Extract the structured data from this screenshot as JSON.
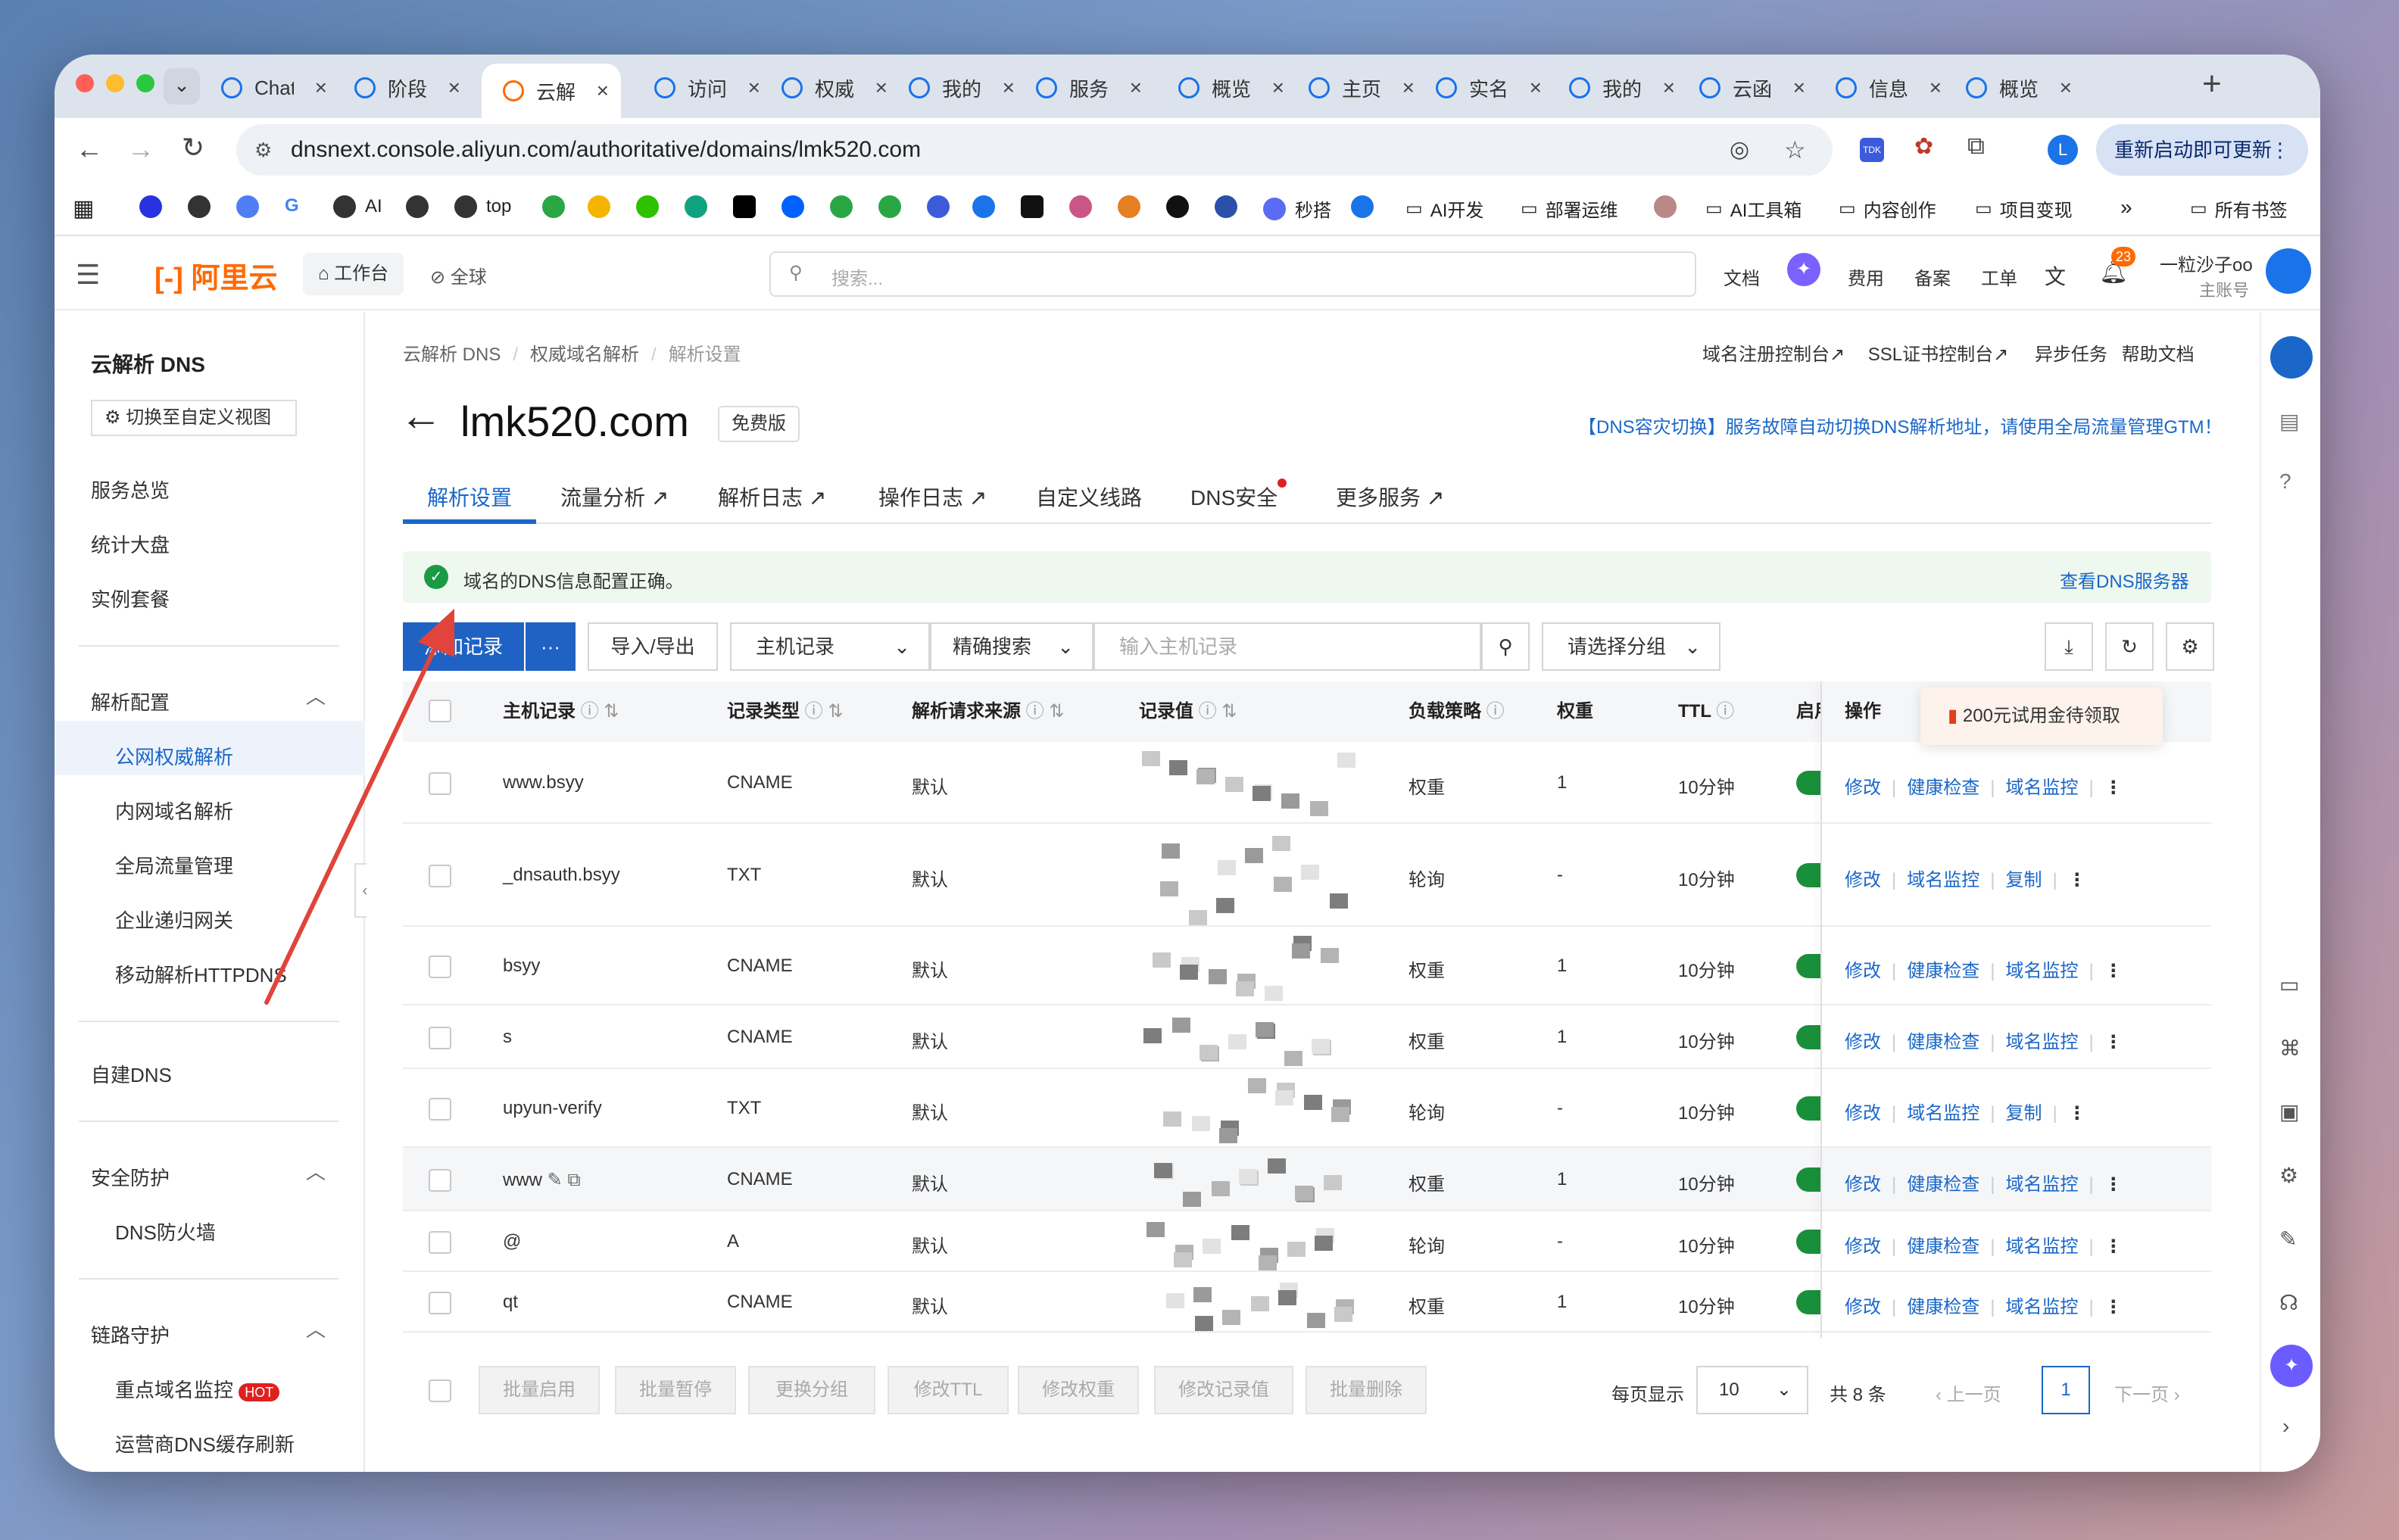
{
  "browser": {
    "tabs": [
      {
        "label": "ChatGPT",
        "active": false
      },
      {
        "label": "阶段",
        "active": false
      },
      {
        "label": "云解析",
        "active": true
      },
      {
        "label": "访问",
        "active": false
      },
      {
        "label": "权威",
        "active": false
      },
      {
        "label": "我的",
        "active": false
      },
      {
        "label": "服务",
        "active": false
      },
      {
        "label": "概览",
        "active": false
      },
      {
        "label": "主页",
        "active": false
      },
      {
        "label": "实名",
        "active": false
      },
      {
        "label": "我的",
        "active": false
      },
      {
        "label": "云函",
        "active": false
      },
      {
        "label": "信息",
        "active": false
      },
      {
        "label": "概览",
        "active": false
      }
    ],
    "url": "dnsnext.console.aliyun.com/authoritative/domains/lmk520.com",
    "update_label": "重新启动即可更新",
    "profile_initial": "L",
    "bookmarks": {
      "ai": "AI",
      "top": "top",
      "miaoda": "秒搭",
      "folder_ai_dev": "AI开发",
      "folder_deploy": "部署运维",
      "folder_ai_tools": "AI工具箱",
      "folder_content": "内容创作",
      "folder_project": "项目变现",
      "all": "所有书签"
    }
  },
  "header": {
    "logo": "阿里云",
    "workbench": "工作台",
    "region": "全球",
    "search_placeholder": "搜索...",
    "docs": "文档",
    "fees": "费用",
    "filing": "备案",
    "tickets": "工单",
    "notifications": "23",
    "user_name": "一粒沙子oo",
    "user_role": "主账号"
  },
  "sidebar": {
    "title": "云解析 DNS",
    "switch_view": "切换至自定义视图",
    "items": {
      "overview": "服务总览",
      "dashboard": "统计大盘",
      "instances": "实例套餐"
    },
    "group_config": "解析配置",
    "config_items": [
      "公网权威解析",
      "内网域名解析",
      "全局流量管理",
      "企业递归网关",
      "移动解析HTTPDNS"
    ],
    "self_dns": "自建DNS",
    "group_security": "安全防护",
    "security_items": [
      "DNS防火墙"
    ],
    "group_chain": "链路守护",
    "chain_items": [
      "重点域名监控",
      "运营商DNS缓存刷新"
    ],
    "hot_badge": "HOT"
  },
  "breadcrumb": [
    "云解析 DNS",
    "权威域名解析",
    "解析设置"
  ],
  "top_links": [
    "域名注册控制台",
    "SSL证书控制台",
    "异步任务",
    "帮助文档"
  ],
  "domain": {
    "name": "lmk520.com",
    "plan": "免费版"
  },
  "notice_link": "【DNS容灾切换】服务故障自动切换DNS解析地址，请使用全局流量管理GTM！",
  "tabs": [
    "解析设置",
    "流量分析",
    "解析日志",
    "操作日志",
    "自定义线路",
    "DNS安全",
    "更多服务"
  ],
  "status_banner": {
    "text": "域名的DNS信息配置正确。",
    "link": "查看DNS服务器"
  },
  "toolbar": {
    "add": "添加记录",
    "more": "···",
    "import_export": "导入/导出",
    "host_select": "主机记录",
    "match_select": "精确搜索",
    "search_placeholder": "输入主机记录",
    "group_select": "请选择分组"
  },
  "promo": "200元试用金待领取",
  "table": {
    "headers": [
      "主机记录",
      "记录类型",
      "解析请求来源",
      "记录值",
      "负载策略",
      "权重",
      "TTL",
      "启用",
      "操作"
    ],
    "rows": [
      {
        "host": "www.bsyy",
        "type": "CNAME",
        "source": "默认",
        "policy": "权重",
        "weight": "1",
        "ttl": "10分钟",
        "ops": [
          "修改",
          "健康检查",
          "域名监控"
        ]
      },
      {
        "host": "_dnsauth.bsyy",
        "type": "TXT",
        "source": "默认",
        "policy": "轮询",
        "weight": "-",
        "ttl": "10分钟",
        "ops": [
          "修改",
          "域名监控",
          "复制"
        ]
      },
      {
        "host": "bsyy",
        "type": "CNAME",
        "source": "默认",
        "policy": "权重",
        "weight": "1",
        "ttl": "10分钟",
        "ops": [
          "修改",
          "健康检查",
          "域名监控"
        ]
      },
      {
        "host": "s",
        "type": "CNAME",
        "source": "默认",
        "policy": "权重",
        "weight": "1",
        "ttl": "10分钟",
        "ops": [
          "修改",
          "健康检查",
          "域名监控"
        ]
      },
      {
        "host": "upyun-verify",
        "type": "TXT",
        "source": "默认",
        "policy": "轮询",
        "weight": "-",
        "ttl": "10分钟",
        "ops": [
          "修改",
          "域名监控",
          "复制"
        ]
      },
      {
        "host": "www",
        "type": "CNAME",
        "source": "默认",
        "policy": "权重",
        "weight": "1",
        "ttl": "10分钟",
        "ops": [
          "修改",
          "健康检查",
          "域名监控"
        ]
      },
      {
        "host": "@",
        "type": "A",
        "source": "默认",
        "policy": "轮询",
        "weight": "-",
        "ttl": "10分钟",
        "ops": [
          "修改",
          "健康检查",
          "域名监控"
        ]
      },
      {
        "host": "qt",
        "type": "CNAME",
        "source": "默认",
        "policy": "权重",
        "weight": "1",
        "ttl": "10分钟",
        "ops": [
          "修改",
          "健康检查",
          "域名监控"
        ]
      }
    ]
  },
  "batch": [
    "批量启用",
    "批量暂停",
    "更换分组",
    "修改TTL",
    "修改权重",
    "修改记录值",
    "批量删除"
  ],
  "pagination": {
    "per_page_label": "每页显示",
    "per_page": "10",
    "total": "共 8 条",
    "prev": "上一页",
    "page": "1",
    "next": "下一页"
  }
}
